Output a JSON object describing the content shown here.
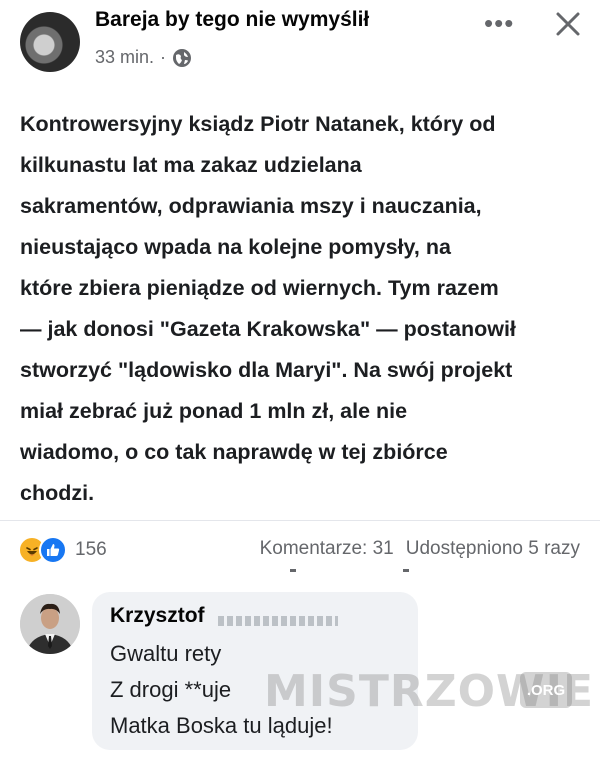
{
  "header": {
    "page_name": "Bareja by tego nie wymyślił",
    "timestamp": "33 min.",
    "separator": "·",
    "more_icon": "more-horizontal-icon",
    "close_icon": "close-icon",
    "privacy_icon": "globe-icon"
  },
  "post": {
    "lines": [
      "Kontrowersyjny ksiądz Piotr Natanek, który od",
      "kilkunastu lat ma zakaz udzielana",
      "sakramentów, odprawiania mszy i nauczania,",
      "nieustająco wpada na kolejne pomysły, na",
      "które zbiera pieniądze od wiernych. Tym razem",
      "— jak donosi \"Gazeta Krakowska\" — postanowił",
      "stworzyć \"lądowisko dla Maryi\". Na swój projekt",
      "miał zebrać już ponad 1 mln zł, ale nie",
      "wiadomo, o co tak naprawdę w tej zbiórce",
      "chodzi."
    ]
  },
  "stats": {
    "reaction_count": "156",
    "comments": "Komentarze: 31",
    "shares": "Udostępniono 5 razy",
    "reaction_icons": [
      "haha-icon",
      "like-icon"
    ]
  },
  "comment": {
    "author": "Krzysztof",
    "lines": [
      "Gwaltu rety",
      "Z drogi **uje",
      "Matka Boska tu ląduje!"
    ]
  },
  "watermark": {
    "text": "MISTRZOWIE",
    "suffix": ".ORG"
  },
  "colors": {
    "text": "#1c1e21",
    "muted": "#65676b",
    "bubble": "#f0f2f5",
    "like": "#1877f2",
    "haha": "#f7b125"
  }
}
